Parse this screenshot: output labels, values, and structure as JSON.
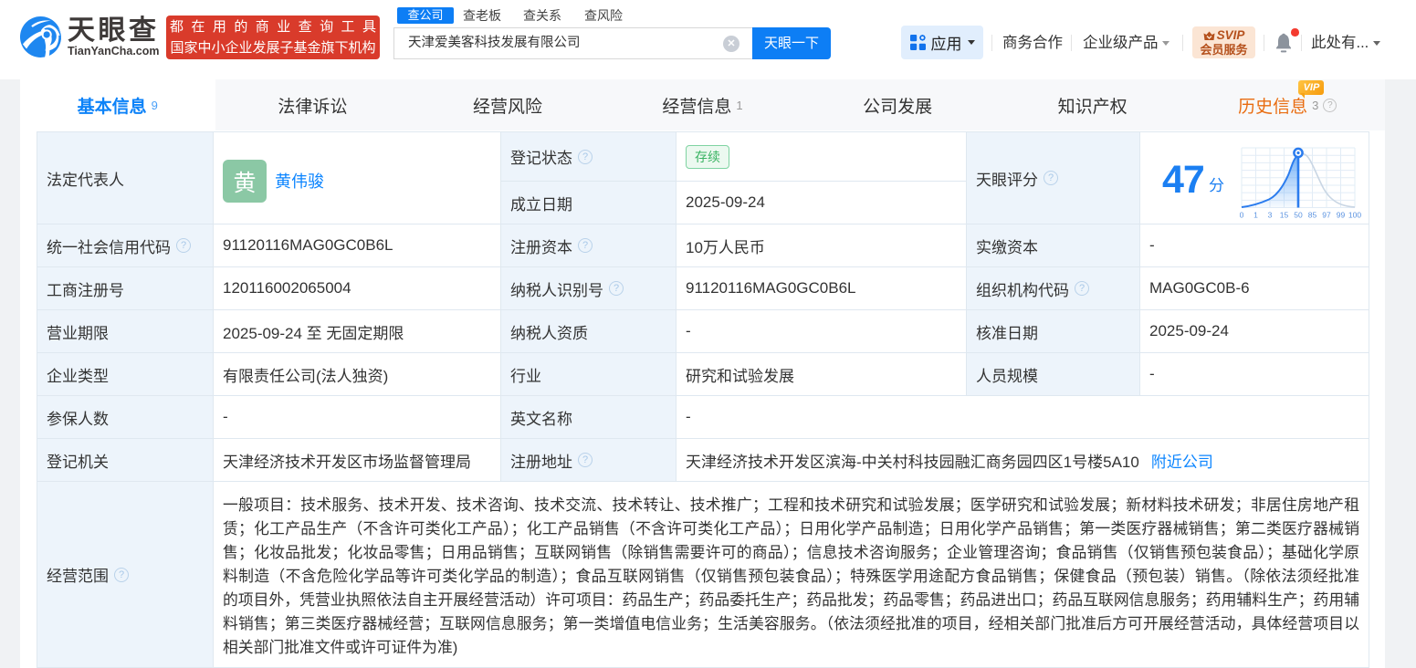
{
  "header": {
    "brand": {
      "name": "天眼查",
      "domain": "TianYanCha.com",
      "slogan_line1": "都在用的商业查询工具",
      "slogan_line2": "国家中小企业发展子基金旗下机构"
    },
    "search": {
      "tabs": [
        "查公司",
        "查老板",
        "查关系",
        "查风险"
      ],
      "active_tab": "查公司",
      "input_value": "天津爱美客科技发展有限公司",
      "button_label": "天眼一下"
    },
    "nav": {
      "apps_label": "应用",
      "cooperation": "商务合作",
      "enterprise": "企业级产品",
      "svip_line1": "SVIP",
      "svip_line2": "会员服务",
      "user_label": "此处有..."
    }
  },
  "tabs": [
    {
      "label": "基本信息",
      "count": "9"
    },
    {
      "label": "法律诉讼",
      "count": ""
    },
    {
      "label": "经营风险",
      "count": ""
    },
    {
      "label": "经营信息",
      "count": "1"
    },
    {
      "label": "公司发展",
      "count": ""
    },
    {
      "label": "知识产权",
      "count": ""
    },
    {
      "label": "历史信息",
      "count": "3",
      "vip": "VIP"
    }
  ],
  "info": {
    "legal_rep_label": "法定代表人",
    "legal_rep_avatar": "黄",
    "legal_rep_name": "黄伟骏",
    "reg_status_label": "登记状态",
    "reg_status_value": "存续",
    "establish_label": "成立日期",
    "establish_value": "2025-09-24",
    "score_label": "天眼评分",
    "score_value": "47",
    "score_unit": "分",
    "credit_code_label": "统一社会信用代码",
    "credit_code_value": "91120116MAG0GC0B6L",
    "reg_capital_label": "注册资本",
    "reg_capital_value": "10万人民币",
    "paid_capital_label": "实缴资本",
    "paid_capital_value": "-",
    "reg_no_label": "工商注册号",
    "reg_no_value": "120116002065004",
    "tax_id_label": "纳税人识别号",
    "tax_id_value": "91120116MAG0GC0B6L",
    "org_code_label": "组织机构代码",
    "org_code_value": "MAG0GC0B-6",
    "term_label": "营业期限",
    "term_value": "2025-09-24 至 无固定期限",
    "tax_quality_label": "纳税人资质",
    "tax_quality_value": "-",
    "approve_date_label": "核准日期",
    "approve_date_value": "2025-09-24",
    "company_type_label": "企业类型",
    "company_type_value": "有限责任公司(法人独资)",
    "industry_label": "行业",
    "industry_value": "研究和试验发展",
    "staff_size_label": "人员规模",
    "staff_size_value": "-",
    "insured_label": "参保人数",
    "insured_value": "-",
    "english_name_label": "英文名称",
    "english_name_value": "-",
    "reg_authority_label": "登记机关",
    "reg_authority_value": "天津经济技术开发区市场监督管理局",
    "address_label": "注册地址",
    "address_value": "天津经济技术开发区滨海-中关村科技园融汇商务园四区1号楼5A10",
    "nearby_link": "附近公司",
    "biz_scope_label": "经营范围"
  },
  "icons": {
    "help_glyph": "?",
    "clear_glyph": "✕"
  },
  "score_chart": {
    "axis_labels": [
      "0",
      "1",
      "3",
      "15",
      "50",
      "85",
      "97",
      "99",
      "100"
    ],
    "marker_at": "50"
  },
  "business_scope_lines": [
    "一般项目：技术服务、技术开发、技术咨询、技术交流、技术转让、技术推广；工程和技术研究和试验发展；医学研究和试验发展；新材料技术研发；非居住房地产租",
    "赁；化工产品生产（不含许可类化工产品）；化工产品销售（不含许可类化工产品）；日用化学产品制造；日用化学产品销售；第一类医疗器械销售；第二类医疗器械销",
    "售；化妆品批发；化妆品零售；日用品销售；互联网销售（除销售需要许可的商品）；信息技术咨询服务；企业管理咨询；食品销售（仅销售预包装食品）；基础化学原",
    "料制造（不含危险化学品等许可类化学品的制造）；食品互联网销售（仅销售预包装食品）；特殊医学用途配方食品销售；保健食品（预包装）销售。（除依法须经批准",
    "的项目外，凭营业执照依法自主开展经营活动）许可项目：药品生产；药品委托生产；药品批发；药品零售；药品进出口；药品互联网信息服务；药用辅料生产；药用辅",
    "料销售；第三类医疗器械经营；互联网信息服务；第一类增值电信业务；生活美容服务。（依法须经批准的项目，经相关部门批准后方可开展经营活动，具体经营项目以",
    "相关部门批准文件或许可证件为准)"
  ]
}
